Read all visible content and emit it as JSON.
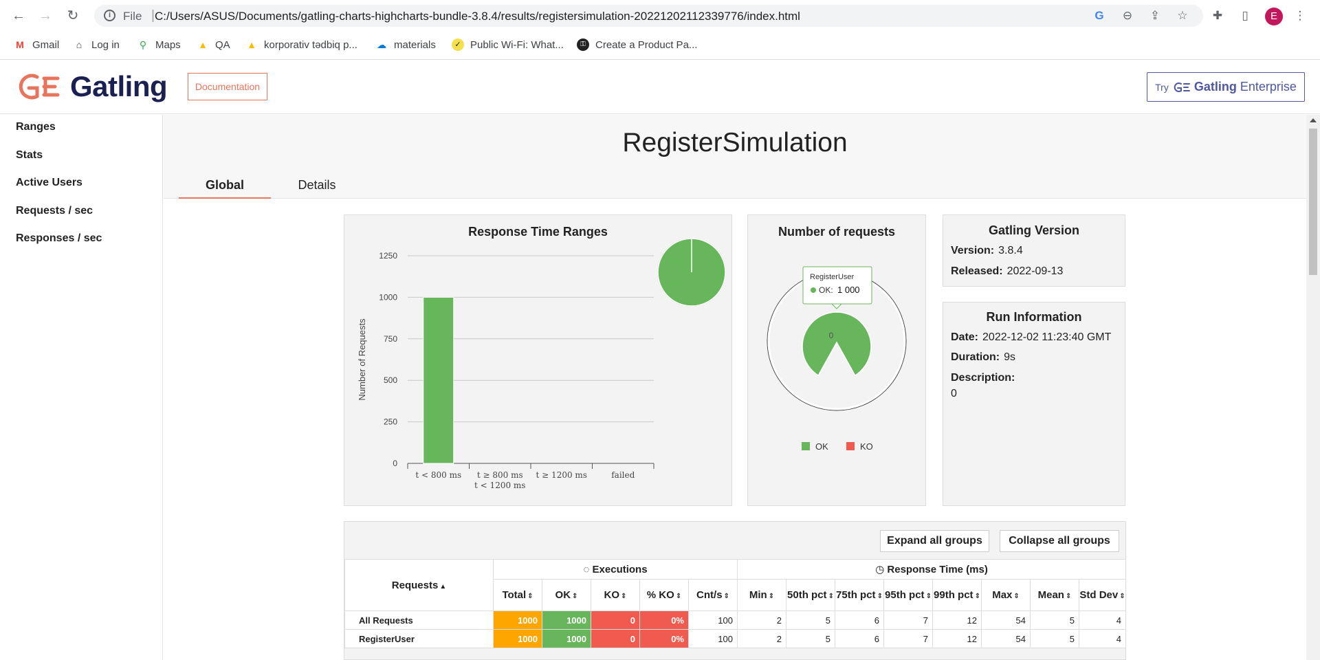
{
  "browser": {
    "scheme": "File",
    "url": "C:/Users/ASUS/Documents/gatling-charts-highcharts-bundle-3.8.4/results/registersimulation-20221202112339776/index.html",
    "avatar_letter": "E",
    "bookmarks": [
      {
        "label": "Gmail",
        "icon": "gmail-icon"
      },
      {
        "label": "Log in",
        "icon": "home-icon"
      },
      {
        "label": "Maps",
        "icon": "maps-icon"
      },
      {
        "label": "QA",
        "icon": "drive-icon"
      },
      {
        "label": "korporativ tədbiq p...",
        "icon": "drive-icon"
      },
      {
        "label": "materials",
        "icon": "onedrive-icon"
      },
      {
        "label": "Public Wi-Fi: What...",
        "icon": "check-icon"
      },
      {
        "label": "Create a Product Pa...",
        "icon": "key-icon"
      }
    ]
  },
  "header": {
    "logo_text": "Gatling",
    "documentation_label": "Documentation",
    "enterprise_try": "Try",
    "enterprise_brand": "Gatling",
    "enterprise_suffix": "Enterprise"
  },
  "sidebar": {
    "items": [
      {
        "label": "Ranges"
      },
      {
        "label": "Stats"
      },
      {
        "label": "Active Users"
      },
      {
        "label": "Requests / sec"
      },
      {
        "label": "Responses / sec"
      }
    ]
  },
  "main": {
    "simulation_title": "RegisterSimulation",
    "tabs": [
      {
        "label": "Global",
        "active": true
      },
      {
        "label": "Details",
        "active": false
      }
    ]
  },
  "colors": {
    "ok": "#68b65c",
    "ko": "#f15b4f",
    "total": "#ffa500",
    "accent": "#e7745b",
    "brand": "#1a2051"
  },
  "chart_data": [
    {
      "type": "bar",
      "title": "Response Time Ranges",
      "ylabel": "Number of Requests",
      "xlabel": "",
      "categories": [
        "t < 800 ms",
        "t ≥ 800 ms\nt < 1200 ms",
        "t ≥ 1200 ms",
        "failed"
      ],
      "values": [
        1000,
        0,
        0,
        0
      ],
      "ylim": [
        0,
        1250
      ],
      "yticks": [
        0,
        250,
        500,
        750,
        1000,
        1250
      ],
      "grid": true,
      "inset_pie": {
        "type": "pie",
        "values": [
          1000,
          0,
          0,
          0
        ]
      }
    },
    {
      "type": "pie",
      "title": "Number of requests",
      "series": [
        {
          "name": "OK",
          "values": [
            1000
          ]
        },
        {
          "name": "KO",
          "values": [
            0
          ]
        }
      ],
      "legend": [
        "OK",
        "KO"
      ],
      "legend_position": "bottom",
      "center_label": "0",
      "tooltip": {
        "title": "RegisterUser",
        "label": "OK:",
        "value": "1 000"
      }
    }
  ],
  "info": {
    "version_title": "Gatling Version",
    "version_label": "Version:",
    "version_value": "3.8.4",
    "released_label": "Released:",
    "released_value": "2022-09-13",
    "run_title": "Run Information",
    "date_label": "Date:",
    "date_value": "2022-12-02 11:23:40 GMT",
    "duration_label": "Duration:",
    "duration_value": "9s",
    "description_label": "Description:",
    "description_value": "0"
  },
  "stats": {
    "expand_label": "Expand all groups",
    "collapse_label": "Collapse all groups",
    "requests_header": "Requests",
    "executions_header": "Executions",
    "response_header": "Response Time (ms)",
    "columns": [
      "Total",
      "OK",
      "KO",
      "% KO",
      "Cnt/s",
      "Min",
      "50th pct",
      "75th pct",
      "95th pct",
      "99th pct",
      "Max",
      "Mean",
      "Std Dev"
    ],
    "rows": [
      {
        "name": "All Requests",
        "cells": [
          "1000",
          "1000",
          "0",
          "0%",
          "100",
          "2",
          "5",
          "6",
          "7",
          "12",
          "54",
          "5",
          "4"
        ]
      },
      {
        "name": "RegisterUser",
        "cells": [
          "1000",
          "1000",
          "0",
          "0%",
          "100",
          "2",
          "5",
          "6",
          "7",
          "12",
          "54",
          "5",
          "4"
        ]
      }
    ]
  }
}
